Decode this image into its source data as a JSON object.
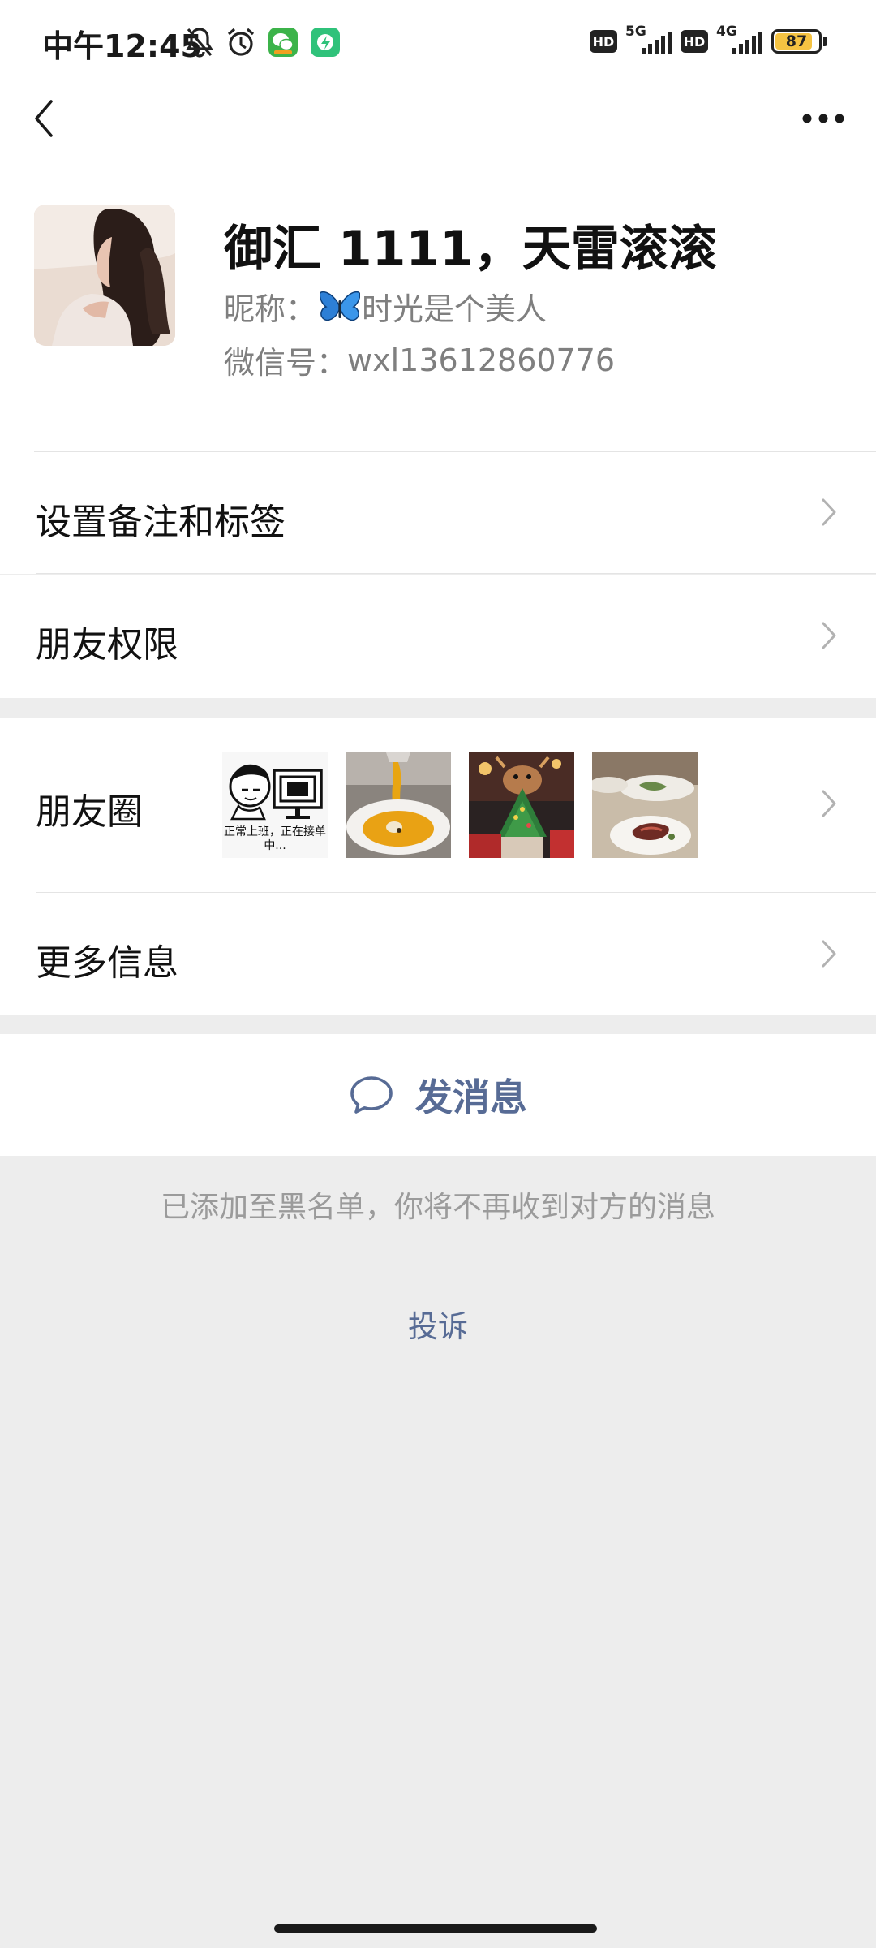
{
  "status_bar": {
    "time": "中午12:45",
    "network_1": "5G",
    "network_2": "4G",
    "hd_label": "HD",
    "battery_percent": "87",
    "battery_level": 0.87,
    "icons_left": [
      "bell-off-icon",
      "alarm-icon",
      "wechat-app-icon",
      "green-app-icon"
    ],
    "icons_right": [
      "hd-badge",
      "signal-5g-icon",
      "hd-badge",
      "signal-4g-icon",
      "battery-icon"
    ]
  },
  "nav": {
    "back_icon": "chevron-left-icon",
    "more_icon": "ellipsis-icon"
  },
  "profile": {
    "name": "御汇 1111，天雷滚滚",
    "nickname_label": "昵称：",
    "nickname_value": "时光是个美人",
    "nickname_emoji_icon": "butterfly-icon",
    "wechat_id_label": "微信号：",
    "wechat_id_value": "wxl13612860776"
  },
  "cells": {
    "remark": "设置备注和标签",
    "permission": "朋友权限",
    "moments": "朋友圈",
    "more_info": "更多信息"
  },
  "moments_thumbs": {
    "meme_caption": "正常上班，正在接单中..."
  },
  "actions": {
    "send_message": "发消息",
    "send_message_icon": "chat-bubble-icon"
  },
  "blacklist_note": "已添加至黑名单，你将不再收到对方的消息",
  "complain_link": "投诉",
  "colors": {
    "link": "#576b95",
    "background": "#ededed",
    "card": "#ffffff",
    "secondary_text": "#7f7f7f"
  }
}
